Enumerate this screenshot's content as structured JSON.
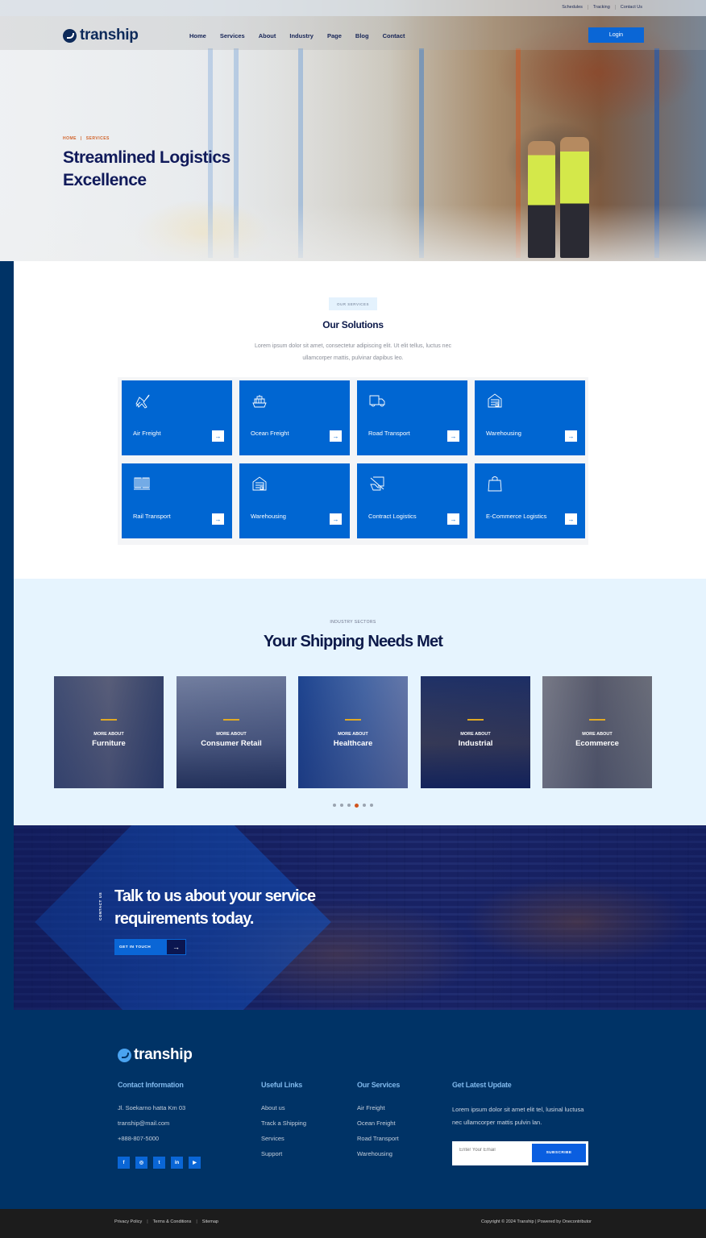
{
  "topbar": {
    "links": [
      "Schedules",
      "Tracking",
      "Contact Us"
    ]
  },
  "brand": {
    "name": "tranship"
  },
  "nav": {
    "items": [
      "Home",
      "Services",
      "About",
      "Industry",
      "Page",
      "Blog",
      "Contact"
    ],
    "login": "Login"
  },
  "hero": {
    "breadcrumb": [
      "HOME",
      "SERVICES"
    ],
    "breadcrumb_sep": "|",
    "title": "Streamlined Logistics Excellence"
  },
  "solutions": {
    "badge": "OUR SERVICES",
    "title": "Our Solutions",
    "description": "Lorem ipsum dolor sit amet, consectetur adipiscing elit. Ut elit tellus, luctus nec ullamcorper mattis, pulvinar dapibus leo.",
    "cards": [
      {
        "label": "Air Freight",
        "icon": "airplane-icon"
      },
      {
        "label": "Ocean Freight",
        "icon": "cargo-ship-icon"
      },
      {
        "label": "Road Transport",
        "icon": "truck-icon"
      },
      {
        "label": "Warehousing",
        "icon": "warehouse-icon"
      },
      {
        "label": "Rail Transport",
        "icon": "rail-container-icon"
      },
      {
        "label": "Warehousing",
        "icon": "warehouse-icon"
      },
      {
        "label": "Contract Logistics",
        "icon": "hand-package-icon"
      },
      {
        "label": "E-Commerce Logistics",
        "icon": "shopping-bag-icon"
      }
    ],
    "arrow": "→"
  },
  "industry": {
    "kicker": "INDUSTRY SECTORS",
    "title": "Your Shipping Needs Met",
    "more_label": "MORE ABOUT",
    "cards": [
      "Furniture",
      "Consumer Retail",
      "Healthcare",
      "Industrial",
      "Ecommerce"
    ],
    "pagination": {
      "total": 6,
      "active_index": 3
    }
  },
  "cta": {
    "side_label": "CONTACT US",
    "title": "Talk to us about your service requirements today.",
    "button": "GET IN TOUCH",
    "button_arrow": "→"
  },
  "footer": {
    "contact": {
      "heading": "Contact Information",
      "address": "Jl. Soekarno hatta Km 03",
      "email": "tranship@mail.com",
      "phone": "+888-807-5000"
    },
    "socials": [
      "f",
      "◎",
      "t",
      "in",
      "▶"
    ],
    "useful_links": {
      "heading": "Useful Links",
      "items": [
        "About us",
        "Track a Shipping",
        "Services",
        "Support"
      ]
    },
    "services": {
      "heading": "Our Services",
      "items": [
        "Air Freight",
        "Ocean Freight",
        "Road Transport",
        "Warehousing"
      ]
    },
    "newsletter": {
      "heading": "Get Latest Update",
      "text": "Lorem ipsum dolor sit amet elit tel, lusinal luctusa nec ullamcorper mattis pulvin lan.",
      "placeholder": "Enter Your Email",
      "button": "SUBSCRIBE"
    }
  },
  "bottom": {
    "links": [
      "Privacy Policy",
      "Terms & Conditions",
      "Sitemap"
    ],
    "copyright": "Copyright © 2024 Tranship | Powered by Onecontributor"
  },
  "colors": {
    "primary": "#0066d2",
    "navy": "#003366",
    "heading": "#0d1a4a",
    "accent_orange": "#d1541e",
    "accent_gold": "#e0a924"
  }
}
